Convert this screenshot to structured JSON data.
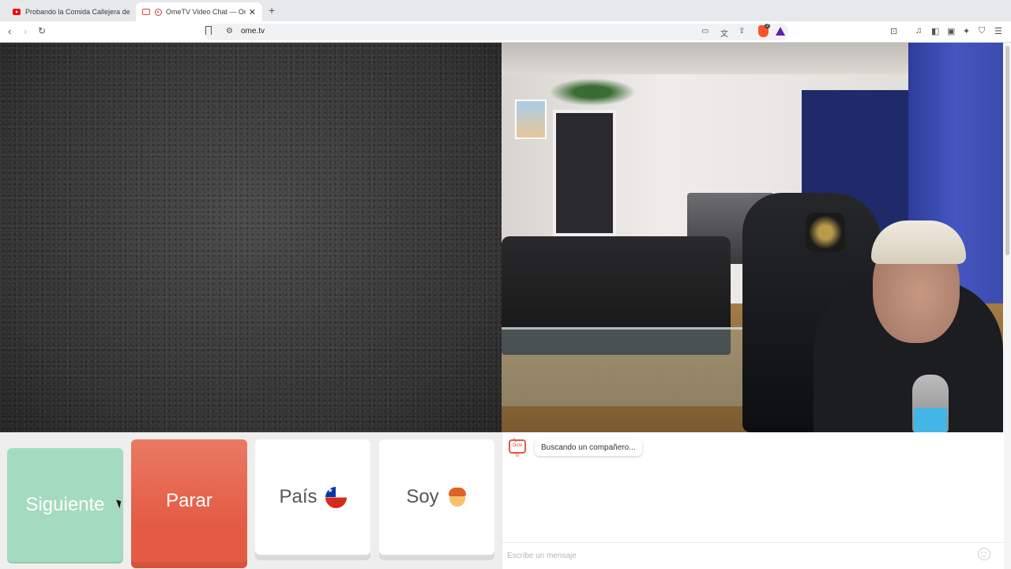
{
  "browser": {
    "tabs": [
      {
        "title": "Probando la Comida Callejera de C",
        "icon": "youtube-icon"
      },
      {
        "title": "OmeTV Video Chat — Omeg",
        "icon": "ometv-favicon",
        "active": true
      }
    ],
    "url": "ome.tv"
  },
  "controls": {
    "next_label": "Siguiente",
    "stop_label": "Parar",
    "country_label": "País",
    "country_icon": "chile-flag-icon",
    "gender_label": "Soy",
    "gender_icon": "boy-face-icon"
  },
  "chat": {
    "logo_text": "Ome tv",
    "status_message": "Buscando un compañero...",
    "input_placeholder": "Escribe un mensaje"
  },
  "colors": {
    "next_button": "#a4dbbe",
    "stop_button": "#e45b43",
    "accent_red": "#e9554a"
  }
}
